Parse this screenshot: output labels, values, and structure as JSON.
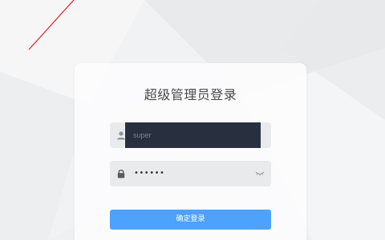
{
  "login": {
    "title": "超级管理员登录",
    "username": {
      "value": "super",
      "icon": "user-icon"
    },
    "password": {
      "masked_value": "••••••",
      "icon": "lock-icon",
      "toggle_icon": "eye-closed-icon"
    },
    "submit_label": "确定登录"
  },
  "colors": {
    "accent": "#4da2fb",
    "background": "#f1f2f4",
    "decoration_line": "#e02020"
  }
}
